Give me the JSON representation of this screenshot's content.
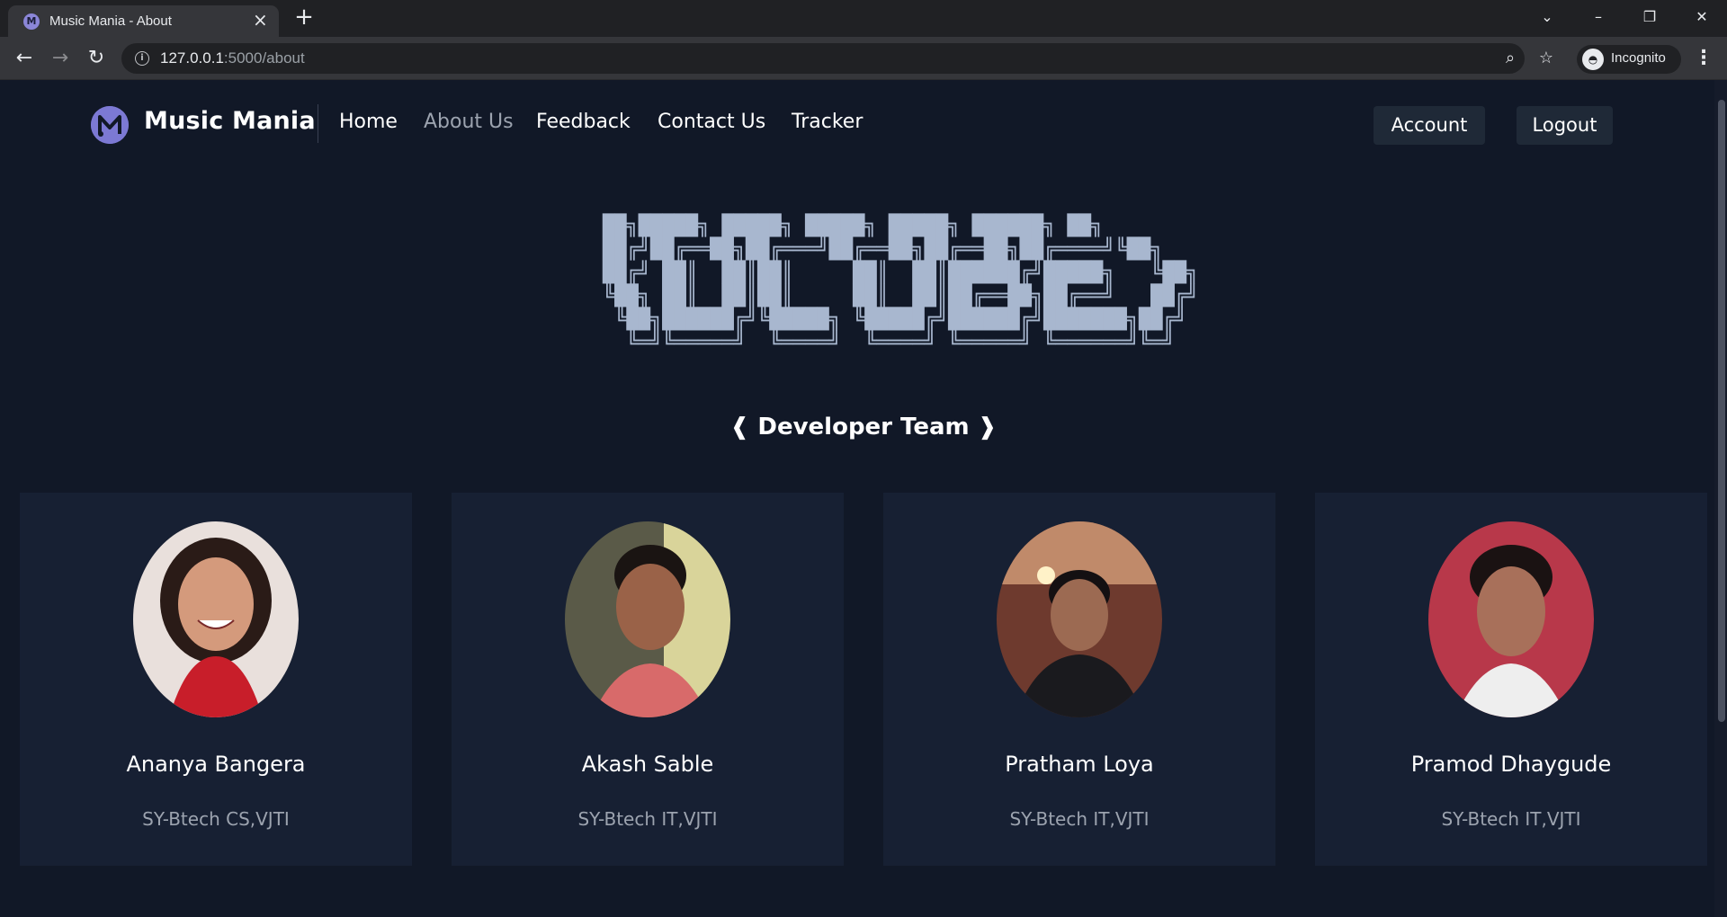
{
  "browser": {
    "tab_title": "Music Mania - About",
    "url_host": "127.0.0.1",
    "url_path": ":5000/about",
    "incognito_label": "Incognito"
  },
  "navbar": {
    "brand": "Music Mania",
    "links": [
      {
        "label": "Home",
        "active": false
      },
      {
        "label": "About Us",
        "active": true
      },
      {
        "label": "Feedback",
        "active": false
      },
      {
        "label": "Contact Us",
        "active": false
      },
      {
        "label": "Tracker",
        "active": false
      }
    ],
    "account_label": "Account",
    "logout_label": "Logout"
  },
  "hero": {
    "ascii_art": "██╗█████╗ █████╗ █████╗ █████╗ ██████╗ ██╗\n██╔╝██╔══██╗██╔═══╝██╔══██╗██╔══██╗██╔════╝╚██╗\n██╔╝ ██║  ██║██║     ██║  ██║██████╔╝█████╗   ╚██╗\n╚██╗ ██║  ██║██║     ██║  ██║██╔══██╗██╔══╝   ██╔╝\n ╚██╗██████╔╝╚█████╗ ╚█████╔╝██████╔╝███████╗██╔╝\n  ╚═╝╚═════╝  ╚════╝  ╚════╝ ╚═════╝ ╚══════╝╚═╝",
    "section_title": "❰ Developer Team ❱"
  },
  "team": [
    {
      "name": "Ananya Bangera",
      "role": "SY-Btech CS,VJTI"
    },
    {
      "name": "Akash Sable",
      "role": "SY-Btech IT,VJTI"
    },
    {
      "name": "Pratham Loya",
      "role": "SY-Btech IT,VJTI"
    },
    {
      "name": "Pramod Dhaygude",
      "role": "SY-Btech IT,VJTI"
    }
  ],
  "colors": {
    "page_bg": "#111827",
    "card_bg": "#172033",
    "button_bg": "#1f2937",
    "muted_text": "#9ca3af",
    "logo": "#7c79d4"
  },
  "icons": {
    "back": "arrow-left-icon",
    "forward": "arrow-right-icon",
    "reload": "reload-icon",
    "zoom": "zoom-icon",
    "bookmark": "star-icon",
    "menu": "kebab-menu-icon"
  }
}
